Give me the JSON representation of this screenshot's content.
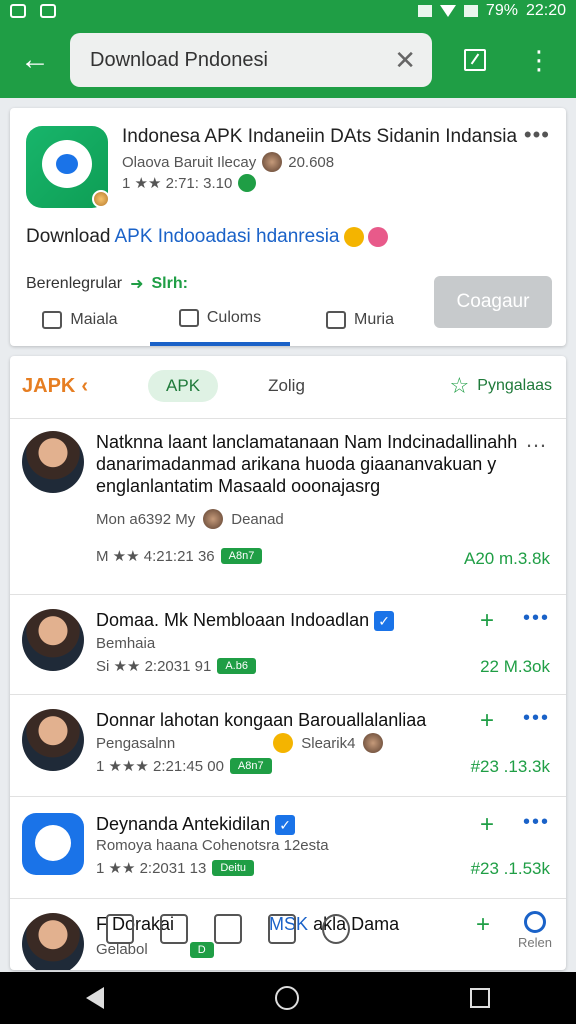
{
  "status": {
    "battery": "79%",
    "time": "22:20"
  },
  "toolbar": {
    "search_value": "Download Pndonesi"
  },
  "featured": {
    "title": "Indonesa APK Indaneiin DAts Sidanin Indansia",
    "subtitle": "Olaova Baruit Ilecay",
    "subtitle_count": "20.608",
    "rating_text": "1 ★★ 2:71: 3.10",
    "download_prefix": "Download",
    "download_link": "APK Indooadasi hdanresia",
    "reg_label": "Berenlegrular",
    "reg_link": "Slrh:",
    "actions": [
      "Maiala",
      "Culoms",
      "Muria"
    ],
    "primary_button": "Coagaur"
  },
  "list_tabs": {
    "logo": "JAPK",
    "tab1": "APK",
    "tab2": "Zolig",
    "tab3": "Pyngalaas"
  },
  "rows": [
    {
      "title_lines": [
        "Natknna laant lanclamatanaan Nam Indcinadallinahh",
        "danarimadanmad arikana huoda giaananvakuan y",
        "englanlantatim Masaald ooonajasrg"
      ],
      "sub": "Mon a6392 My",
      "sub_tag": "Deanad",
      "meta": "M ★★ 4:21:21 36",
      "badge": "A8n7",
      "price": "A20 m.3.8k"
    },
    {
      "title": "Domaa. Mk Nembloaan Indoadlan",
      "sub": "Bemhaia",
      "meta": "Si ★★ 2:2031 91",
      "badge": "A.b6",
      "price": "22 M.3ok"
    },
    {
      "title": "Donnar lahotan kongaan Barouallalanliaa",
      "sub": "Pengasalnn",
      "sub_tag": "Slearik4",
      "meta": "1 ★★★ 2:21:45 00",
      "badge": "A8n7",
      "price": "#23 .13.3k"
    },
    {
      "title": "Deynanda Antekidilan",
      "sub": "Romoya haana Cohenotsra 12esta",
      "meta": "1 ★★ 2:2031 13",
      "badge": "Deitu",
      "price": "#23 .1.53k"
    },
    {
      "title": "F Dorakai",
      "title_link": "MSK",
      "title_tail": "akla Dama",
      "sub": "Gelabol",
      "badge": "D",
      "footer_right": "Relen"
    }
  ]
}
